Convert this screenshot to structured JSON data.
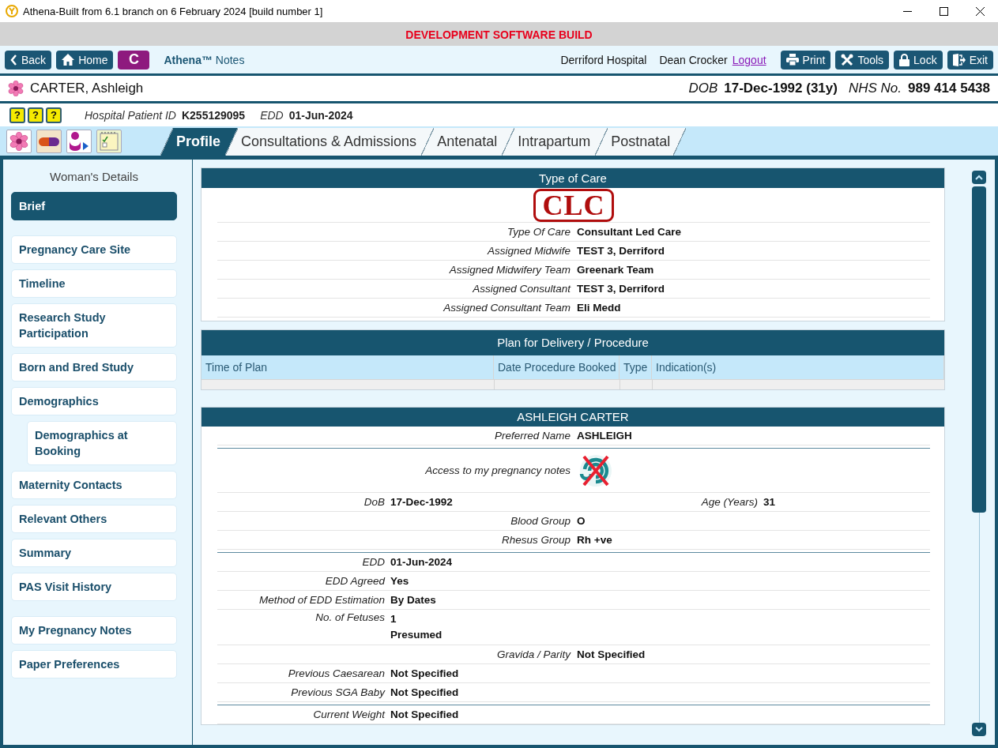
{
  "window": {
    "title": "Athena-Built from 6.1 branch on 6 February 2024 [build number 1]"
  },
  "banner": "DEVELOPMENT SOFTWARE BUILD",
  "toolbar": {
    "buttons": [
      {
        "kind": "back",
        "label": "Back"
      },
      {
        "kind": "home",
        "label": "Home"
      },
      {
        "kind": "letter",
        "label": "C"
      }
    ],
    "app_name": "**Athena™** Notes",
    "hospital": "Derriford Hospital",
    "user": "Dean Crocker",
    "logout": "Logout",
    "actions": [
      {
        "kind": "print",
        "label": "Print"
      },
      {
        "kind": "tools",
        "label": "Tools"
      },
      {
        "kind": "lock",
        "label": "Lock"
      },
      {
        "kind": "exit",
        "label": "Exit"
      }
    ]
  },
  "help_buttons": [
    "?",
    "?",
    "?"
  ],
  "patient": {
    "name": "CARTER, Ashleigh",
    "dob_label": "DOB",
    "dob": "17-Dec-1992 (31y)",
    "nhs_label": "NHS No.",
    "nhs": "989 414 5438",
    "id_label": "Hospital Patient ID",
    "id": "K255129095",
    "edd_label": "EDD",
    "edd": "01-Jun-2024"
  },
  "tabs": [
    {
      "label": "Profile",
      "selected": true
    },
    {
      "label": "Consultations & Admissions",
      "selected": false
    },
    {
      "label": "Antenatal",
      "selected": false
    },
    {
      "label": "Intrapartum",
      "selected": false
    },
    {
      "label": "Postnatal",
      "selected": false
    }
  ],
  "sidebar": {
    "heading": "Woman's Details",
    "groups": [
      {
        "items": [
          {
            "label": "Brief",
            "selected": true
          }
        ]
      },
      {
        "items": [
          {
            "label": "Pregnancy Care Site",
            "selected": false
          },
          {
            "label": "Timeline",
            "selected": false
          },
          {
            "label": "Research Study Participation",
            "selected": false
          },
          {
            "label": "Born and Bred Study",
            "selected": false
          },
          {
            "label": "Demographics",
            "selected": false,
            "children": [
              {
                "label": "Demographics at Booking",
                "selected": false
              }
            ]
          },
          {
            "label": "Maternity Contacts",
            "selected": false
          },
          {
            "label": "Relevant Others",
            "selected": false
          },
          {
            "label": "Summary",
            "selected": false
          },
          {
            "label": "PAS Visit History",
            "selected": false
          }
        ]
      },
      {
        "items": [
          {
            "label": "My Pregnancy Notes",
            "selected": false
          },
          {
            "label": "Paper Preferences",
            "selected": false
          }
        ]
      }
    ]
  },
  "type_of_care": {
    "title": "Type of Care",
    "stamp": "CLC",
    "rows": [
      {
        "label": "Type Of Care",
        "value": "Consultant Led Care"
      },
      {
        "label": "Assigned Midwife",
        "value": "TEST 3, Derriford"
      },
      {
        "label": "Assigned Midwifery Team",
        "value": "Greenark Team"
      },
      {
        "label": "Assigned Consultant",
        "value": "TEST 3, Derriford"
      },
      {
        "label": "Assigned Consultant Team",
        "value": "Eli Medd"
      }
    ]
  },
  "plan": {
    "title": "Plan for Delivery / Procedure",
    "columns": [
      "Time of Plan",
      "Date Procedure Booked",
      "Type",
      "Indication(s)"
    ]
  },
  "woman": {
    "title": "ASHLEIGH CARTER",
    "rows": [
      {
        "kind": "center",
        "label": "Preferred Name",
        "value": "ASHLEIGH"
      },
      {
        "kind": "rule"
      },
      {
        "kind": "icon",
        "label": "Access to my pregnancy notes"
      },
      {
        "kind": "pair",
        "label": "DoB",
        "value": "17-Dec-1992",
        "label_2": "Age (Years)",
        "value_2": "31"
      },
      {
        "kind": "center",
        "label": "Blood Group",
        "value": "O"
      },
      {
        "kind": "center",
        "label": "Rhesus Group",
        "value": "Rh +ve"
      },
      {
        "kind": "rule"
      },
      {
        "kind": "left",
        "label": "EDD",
        "value": "01-Jun-2024"
      },
      {
        "kind": "left",
        "label": "EDD Agreed",
        "value": "Yes"
      },
      {
        "kind": "left",
        "label": "Method of EDD Estimation",
        "value": "By Dates"
      },
      {
        "kind": "left",
        "label": "No. of Fetuses",
        "value": "1",
        "value_note": "Presumed"
      },
      {
        "kind": "center",
        "label": "Gravida / Parity",
        "value": "Not Specified"
      },
      {
        "kind": "left",
        "label": "Previous Caesarean",
        "value": "Not Specified"
      },
      {
        "kind": "left",
        "label": "Previous SGA Baby",
        "value": "Not Specified"
      },
      {
        "kind": "rule"
      },
      {
        "kind": "left",
        "label": "Current Weight",
        "value": "Not Specified"
      }
    ]
  }
}
